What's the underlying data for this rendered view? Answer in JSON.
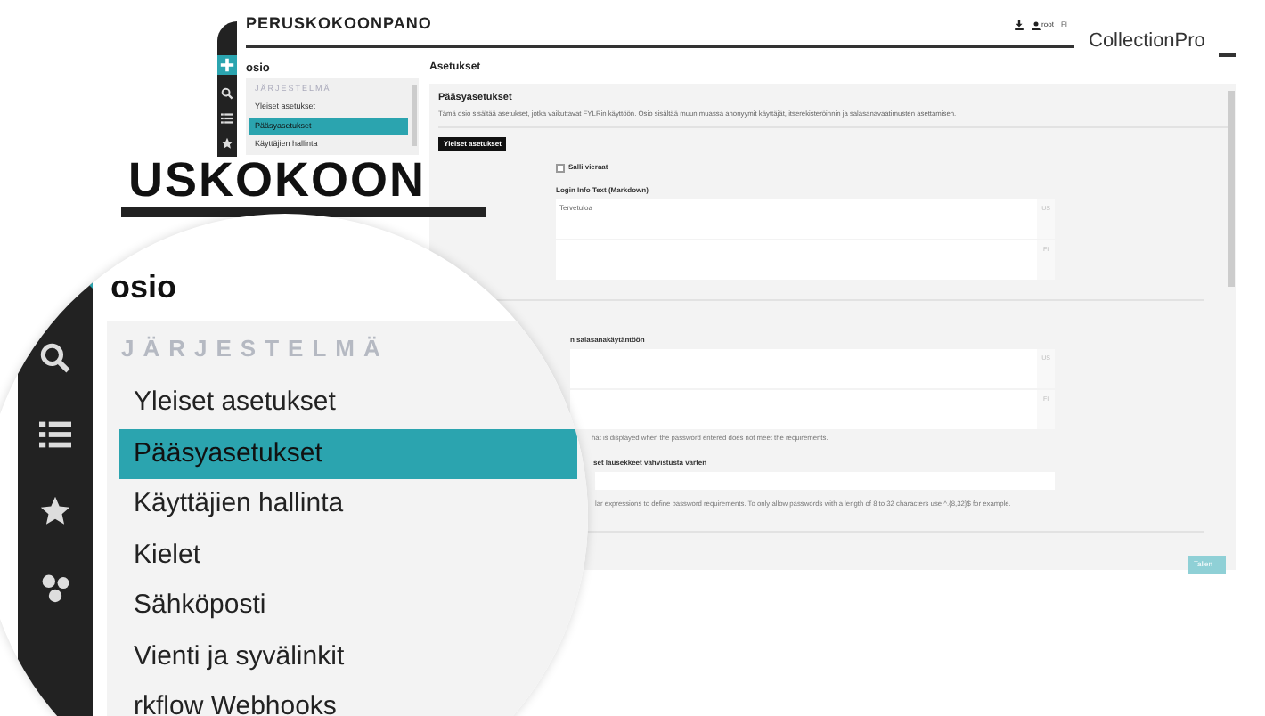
{
  "header": {
    "title": "PERUSKOKOONPANO",
    "user": "root",
    "language": "FI"
  },
  "brand": "CollectionPro",
  "section_title": "osio",
  "sidebar": {
    "group": "JÄRJESTELMÄ",
    "items": [
      {
        "label": "Yleiset asetukset",
        "selected": false
      },
      {
        "label": "Pääsyasetukset",
        "selected": true
      },
      {
        "label": "Käyttäjien hallinta",
        "selected": false
      }
    ]
  },
  "main": {
    "title": "Asetukset",
    "panel_title": "Pääsyasetukset",
    "description": "Tämä osio sisältää asetukset, jotka vaikuttavat FYLRin käyttöön. Osio sisältää muun muassa anonyymit käyttäjät, itserekisteröinnin ja salasanavaatimusten asettamisen.",
    "tab_button": "Yleiset asetukset",
    "guest_checkbox": {
      "label": "Salli vieraat",
      "checked": false
    },
    "login_info": {
      "label": "Login Info Text (Markdown)",
      "fields": [
        {
          "value": "Tervetuloa",
          "lang": "US"
        },
        {
          "lang": "FI"
        }
      ]
    },
    "policy": {
      "label": "n salasanakäytäntöön",
      "fields": [
        {
          "lang": "US"
        },
        {
          "lang": "FI"
        }
      ],
      "hint": "hat is displayed when the password entered does not meet the requirements."
    },
    "regex": {
      "label": "set lausekkeet vahvistusta varten",
      "hint": "lar expressions to define password requirements. To only allow passwords with a length of 8 to 32 characters use ^.{8,32}$ for example."
    },
    "save_button": "Tallen"
  },
  "magnifier": {
    "banner": "USKOKOON",
    "section_title": "osio",
    "group": "JÄRJESTELMÄ",
    "items": [
      {
        "label": "Yleiset asetukset",
        "selected": false
      },
      {
        "label": "Pääsyasetukset",
        "selected": true
      },
      {
        "label": "Käyttäjien hallinta",
        "selected": false
      },
      {
        "label": "Kielet",
        "selected": false
      },
      {
        "label": "Sähköposti",
        "selected": false
      },
      {
        "label": "Vienti ja syvälinkit",
        "selected": false
      },
      {
        "label": "rkflow Webhooks",
        "selected": false
      }
    ]
  }
}
